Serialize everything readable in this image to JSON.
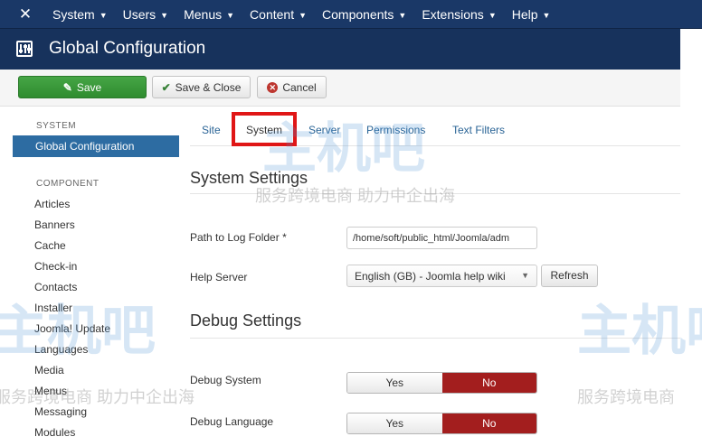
{
  "topnav": {
    "logo_icon": "joomla-logo-icon",
    "items": [
      {
        "label": "System"
      },
      {
        "label": "Users"
      },
      {
        "label": "Menus"
      },
      {
        "label": "Content"
      },
      {
        "label": "Components"
      },
      {
        "label": "Extensions"
      },
      {
        "label": "Help"
      }
    ]
  },
  "header": {
    "icon": "equalizer-icon",
    "title": "Global Configuration"
  },
  "toolbar": {
    "save_label": "Save",
    "save_close_label": "Save & Close",
    "cancel_label": "Cancel"
  },
  "sidebar": {
    "system_heading": "SYSTEM",
    "active_item": "Global Configuration",
    "component_heading": "COMPONENT",
    "items": [
      "Articles",
      "Banners",
      "Cache",
      "Check-in",
      "Contacts",
      "Installer",
      "Joomla! Update",
      "Languages",
      "Media",
      "Menus",
      "Messaging",
      "Modules"
    ]
  },
  "tabs": [
    {
      "label": "Site"
    },
    {
      "label": "System",
      "active": true
    },
    {
      "label": "Server"
    },
    {
      "label": "Permissions"
    },
    {
      "label": "Text Filters"
    }
  ],
  "system_settings": {
    "title": "System Settings",
    "log_path_label": "Path to Log Folder *",
    "log_path_value": "/home/soft/public_html/Joomla/adm",
    "help_server_label": "Help Server",
    "help_server_value": "English (GB) - Joomla help wiki",
    "refresh_label": "Refresh"
  },
  "debug_settings": {
    "title": "Debug Settings",
    "debug_system_label": "Debug System",
    "debug_language_label": "Debug Language",
    "yes_label": "Yes",
    "no_label": "No",
    "debug_system_value": "No",
    "debug_language_value": "No"
  },
  "watermark": {
    "brand": "主机吧",
    "tagline": "服务跨境电商 助力中企出海",
    "tagline_short": "服务跨境电商"
  },
  "colors": {
    "topnav_bg": "#1a3867",
    "header_bg": "#17325c",
    "save_green": "#46a546",
    "active_blue": "#2d6ca2",
    "toggle_no_red": "#a31e1e",
    "highlight_red": "#e01616"
  }
}
